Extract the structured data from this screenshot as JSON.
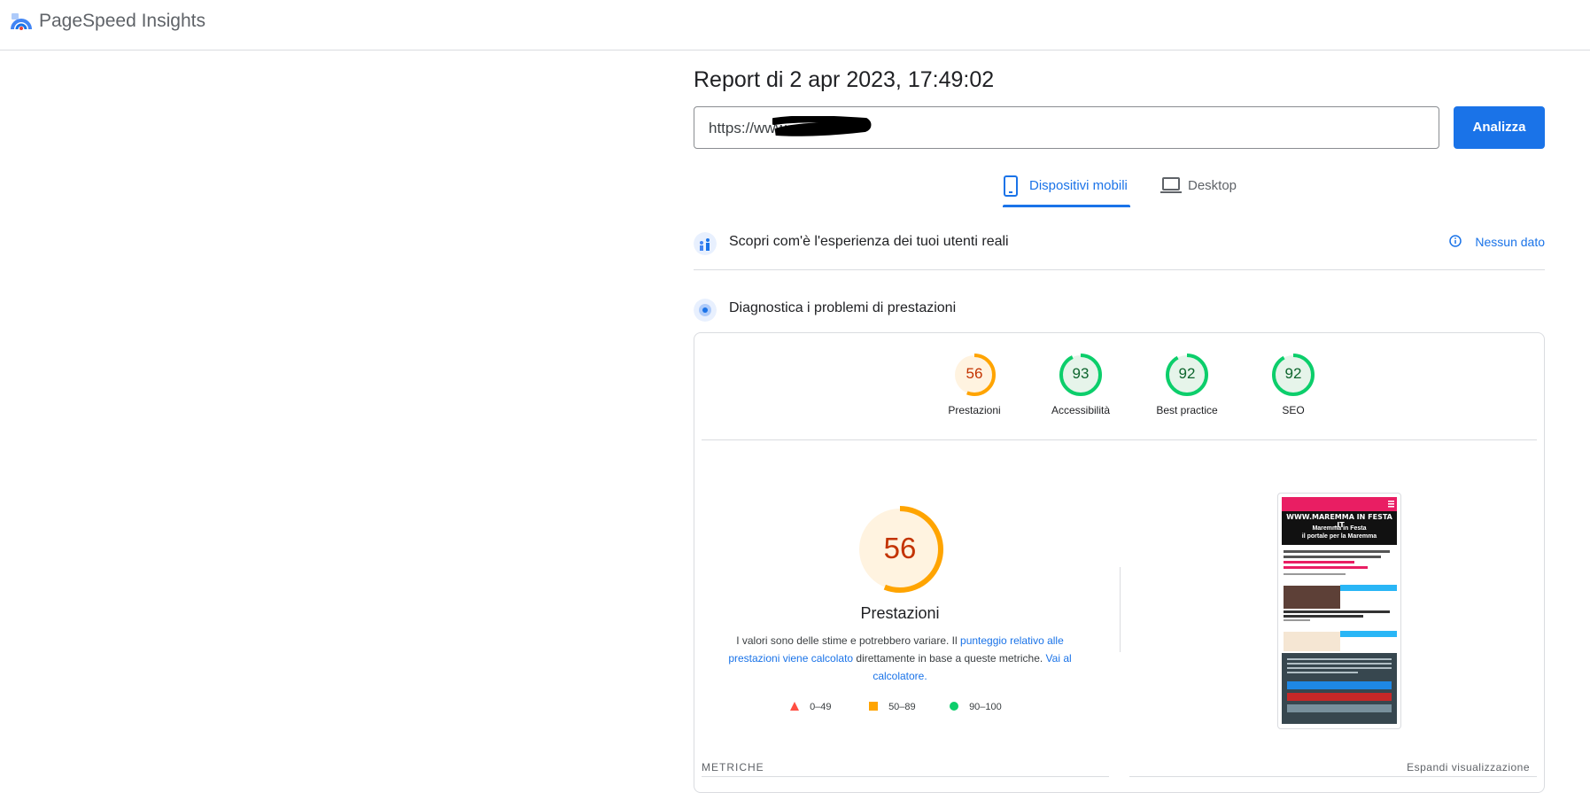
{
  "app": {
    "brand": "PageSpeed Insights"
  },
  "report": {
    "title": "Report di 2 apr 2023, 17:49:02"
  },
  "search": {
    "url_value": "https://www",
    "analyze_label": "Analizza"
  },
  "tabs": [
    {
      "label": "Dispositivi mobili",
      "icon": "smartphone-icon",
      "active": true
    },
    {
      "label": "Desktop",
      "icon": "laptop-icon",
      "active": false
    }
  ],
  "real_users": {
    "title": "Scopri com'è l'esperienza dei tuoi utenti reali",
    "status": "Nessun dato"
  },
  "diagnostics": {
    "title": "Diagnostica i problemi di prestazioni"
  },
  "scores": [
    {
      "label": "Prestazioni",
      "value": "56",
      "score": 56,
      "color": "#ffa400",
      "text_color": "#c33300",
      "bg": "#fff3e0"
    },
    {
      "label": "Accessibilità",
      "value": "93",
      "score": 93,
      "color": "#0cce6b",
      "text_color": "#0d652d",
      "bg": "#e6f4ea"
    },
    {
      "label": "Best practice",
      "value": "92",
      "score": 92,
      "color": "#0cce6b",
      "text_color": "#0d652d",
      "bg": "#e6f4ea"
    },
    {
      "label": "SEO",
      "value": "92",
      "score": 92,
      "color": "#0cce6b",
      "text_color": "#0d652d",
      "bg": "#e6f4ea"
    }
  ],
  "performance": {
    "value": "56",
    "score": 56,
    "label": "Prestazioni",
    "desc_prefix": "I valori sono delle stime e potrebbero variare. Il ",
    "desc_link1": "punteggio relativo alle prestazioni viene calcolato",
    "desc_middle": " direttamente in base a queste metriche. ",
    "desc_link2": "Vai al calcolatore."
  },
  "legend": [
    {
      "range": "0–49",
      "color": "#ff4e42",
      "shape": "triangle"
    },
    {
      "range": "50–89",
      "color": "#ffa400",
      "shape": "square"
    },
    {
      "range": "90–100",
      "color": "#0cce6b",
      "shape": "circle"
    }
  ],
  "screenshot": {
    "site_logo": "WWW.MAREMMA IN FESTA .IT",
    "headline": "Maremma in Festa",
    "subline": "il portale per la Maremma"
  },
  "metrics": {
    "label": "METRICHE",
    "expand": "Espandi visualizzazione"
  },
  "colors": {
    "accent": "#1a73e8",
    "border": "#dadce0"
  }
}
